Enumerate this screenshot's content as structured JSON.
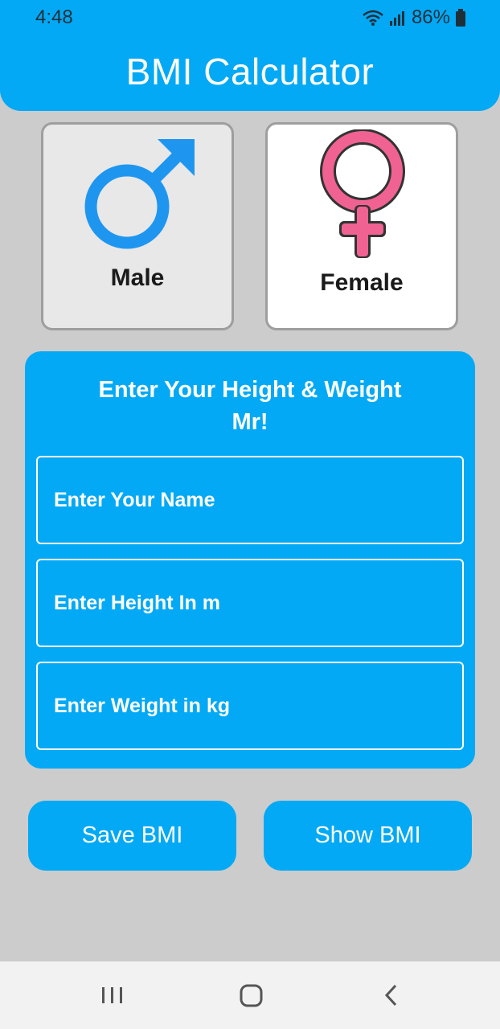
{
  "status": {
    "time": "4:48",
    "battery": "86%"
  },
  "app": {
    "title": "BMI Calculator"
  },
  "gender": {
    "male_label": "Male",
    "female_label": "Female",
    "selected": "male"
  },
  "form": {
    "heading_line1": "Enter Your Height & Weight",
    "heading_line2": "Mr!",
    "name_placeholder": "Enter Your Name",
    "height_placeholder": "Enter Height In m",
    "weight_placeholder": "Enter Weight in kg"
  },
  "buttons": {
    "save_label": "Save BMI",
    "show_label": "Show BMI"
  },
  "colors": {
    "accent": "#03a9f4",
    "background": "#cccccc",
    "female_pink": "#f06292",
    "male_blue": "#1e96f0"
  },
  "icons": {
    "male": "male-symbol-icon",
    "female": "female-symbol-icon"
  }
}
